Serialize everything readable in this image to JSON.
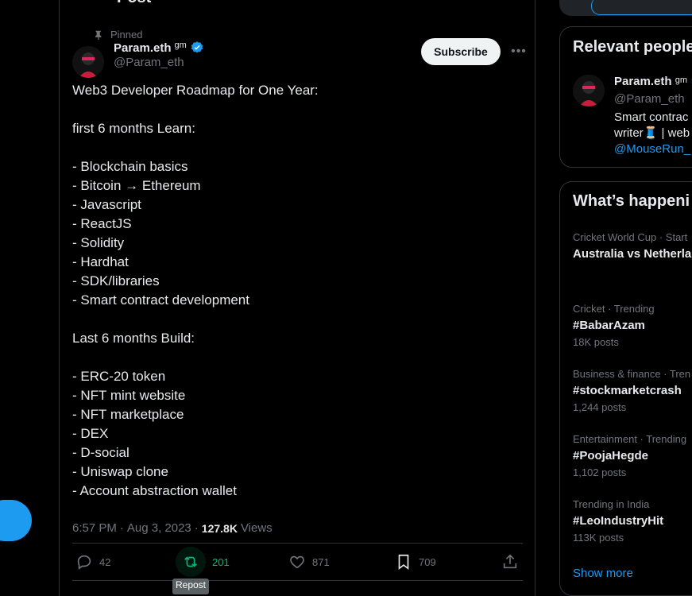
{
  "post_header": {
    "title": "Post"
  },
  "pinned_label": "Pinned",
  "author": {
    "name": "Param.eth",
    "badge": "gm",
    "handle": "@Param_eth",
    "subscribe_label": "Subscribe"
  },
  "post_lines": [
    "Web3 Developer Roadmap for One Year:",
    "",
    "first 6 months Learn:",
    "",
    "- Blockchain basics",
    "- Bitcoin → Ethereum",
    "- Javascript",
    "- ReactJS",
    "- Solidity",
    "- Hardhat",
    "- SDK/libraries",
    "- Smart contract development",
    "",
    "Last 6 months Build:",
    "",
    "- ERC-20 token",
    "- NFT mint website",
    "- NFT marketplace",
    "- DEX",
    "- D-social",
    "- Uniswap clone",
    "- Account abstraction wallet"
  ],
  "meta": {
    "time": "6:57 PM",
    "date": "Aug 3, 2023",
    "views": "127.8K",
    "views_label": "Views"
  },
  "actions": {
    "replies": "42",
    "retweets": "201",
    "likes": "871",
    "bookmarks": "709",
    "tooltip": "Repost"
  },
  "relevant_people": {
    "title": "Relevant people",
    "name": "Param.eth",
    "badge": "gm",
    "handle": "@Param_eth",
    "bio_line1": "Smart contrac",
    "bio_line2": "writer🧵 | web",
    "bio_link": "@MouseRun_"
  },
  "whats_happening": {
    "title": "What’s happeni",
    "trends": [
      {
        "context": "Cricket World Cup · Start",
        "tag": "Australia vs Netherlan",
        "count": ""
      },
      {
        "context": "Cricket · Trending",
        "tag": "#BabarAzam",
        "count": "18K posts"
      },
      {
        "context": "Business & finance · Tren",
        "tag": "#stockmarketcrash",
        "count": "1,244 posts"
      },
      {
        "context": "Entertainment · Trending",
        "tag": "#PoojaHegde",
        "count": "1,102 posts"
      },
      {
        "context": "Trending in India",
        "tag": "#LeoIndustryHit",
        "count": "113K posts"
      }
    ],
    "show_more": "Show more"
  },
  "colors": {
    "accent": "#1d9bf0",
    "retweet": "#00ba7c",
    "muted": "#71767b"
  }
}
